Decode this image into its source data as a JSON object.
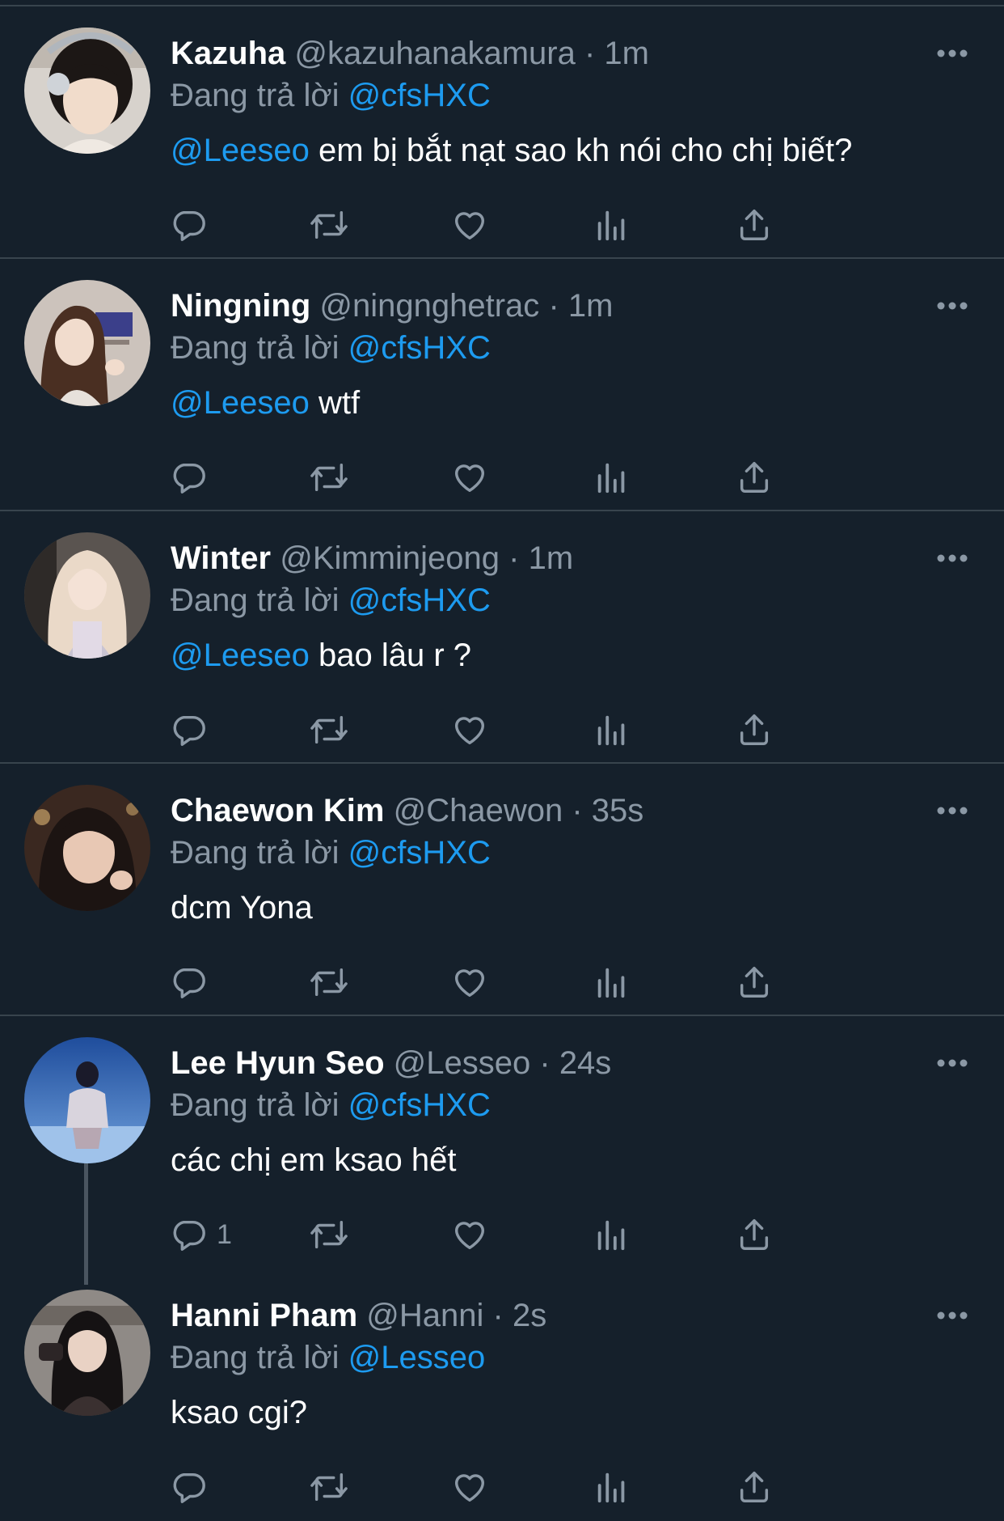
{
  "reply_prefix": "Đang trả lời",
  "dot": "·",
  "tweets": [
    {
      "name": "Kazuha",
      "handle": "@kazuhanakamura",
      "time": "1m",
      "reply_to": "@cfsHXC",
      "mention": "@Leeseo",
      "text": "em bị bắt nạt sao kh nói cho chị biết?",
      "reply_count": ""
    },
    {
      "name": "Ningning",
      "handle": "@ningnghetrac",
      "time": "1m",
      "reply_to": "@cfsHXC",
      "mention": "@Leeseo",
      "text": "wtf",
      "reply_count": ""
    },
    {
      "name": "Winter",
      "handle": "@Kimminjeong",
      "time": "1m",
      "reply_to": "@cfsHXC",
      "mention": "@Leeseo",
      "text": "bao lâu r ?",
      "reply_count": ""
    },
    {
      "name": "Chaewon Kim",
      "handle": "@Chaewon",
      "time": "35s",
      "reply_to": "@cfsHXC",
      "mention": "",
      "text": "dcm Yona",
      "reply_count": ""
    },
    {
      "name": "Lee Hyun Seo",
      "handle": "@Lesseo",
      "time": "24s",
      "reply_to": "@cfsHXC",
      "mention": "",
      "text": "các chị em ksao hết",
      "reply_count": "1"
    },
    {
      "name": "Hanni Pham",
      "handle": "@Hanni",
      "time": "2s",
      "reply_to": "@Lesseo",
      "mention": "",
      "text": "ksao cgi?",
      "reply_count": ""
    }
  ],
  "icons": {
    "reply": "reply-icon",
    "retweet": "retweet-icon",
    "like": "heart-icon",
    "views": "views-icon",
    "share": "share-icon",
    "more": "more-icon"
  },
  "colors": {
    "background": "#15202b",
    "divider": "#38444d",
    "muted": "#8b98a5",
    "accent": "#1d9bf0",
    "text": "#ffffff"
  }
}
